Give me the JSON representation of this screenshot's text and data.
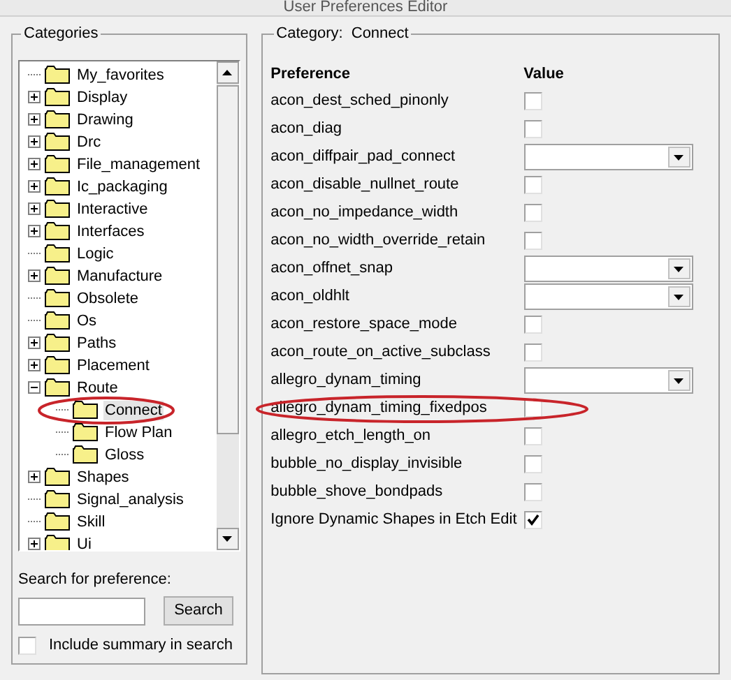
{
  "window": {
    "title": "User Preferences Editor"
  },
  "categories": {
    "title": "Categories",
    "tree": [
      {
        "label": "My_favorites",
        "kind": "leaf",
        "selected": false,
        "highlighted": false
      },
      {
        "label": "Display",
        "kind": "collapsed",
        "selected": false,
        "highlighted": false
      },
      {
        "label": "Drawing",
        "kind": "collapsed",
        "selected": false,
        "highlighted": false
      },
      {
        "label": "Drc",
        "kind": "collapsed",
        "selected": false,
        "highlighted": false
      },
      {
        "label": "File_management",
        "kind": "collapsed",
        "selected": false,
        "highlighted": false
      },
      {
        "label": "Ic_packaging",
        "kind": "collapsed",
        "selected": false,
        "highlighted": false
      },
      {
        "label": "Interactive",
        "kind": "collapsed",
        "selected": false,
        "highlighted": false
      },
      {
        "label": "Interfaces",
        "kind": "collapsed",
        "selected": false,
        "highlighted": false
      },
      {
        "label": "Logic",
        "kind": "leaf",
        "selected": false,
        "highlighted": false
      },
      {
        "label": "Manufacture",
        "kind": "collapsed",
        "selected": false,
        "highlighted": false
      },
      {
        "label": "Obsolete",
        "kind": "leaf",
        "selected": false,
        "highlighted": false
      },
      {
        "label": "Os",
        "kind": "leaf",
        "selected": false,
        "highlighted": false
      },
      {
        "label": "Paths",
        "kind": "collapsed",
        "selected": false,
        "highlighted": false
      },
      {
        "label": "Placement",
        "kind": "collapsed",
        "selected": false,
        "highlighted": false
      },
      {
        "label": "Route",
        "kind": "expanded",
        "selected": false,
        "highlighted": false,
        "children": [
          {
            "label": "Connect",
            "kind": "leaf",
            "selected": true,
            "highlighted": true
          },
          {
            "label": "Flow Plan",
            "kind": "leaf",
            "selected": false,
            "highlighted": false
          },
          {
            "label": "Gloss",
            "kind": "leaf",
            "selected": false,
            "highlighted": false
          }
        ]
      },
      {
        "label": "Shapes",
        "kind": "collapsed",
        "selected": false,
        "highlighted": false
      },
      {
        "label": "Signal_analysis",
        "kind": "leaf",
        "selected": false,
        "highlighted": false
      },
      {
        "label": "Skill",
        "kind": "leaf",
        "selected": false,
        "highlighted": false
      },
      {
        "label": "Ui",
        "kind": "collapsed",
        "selected": false,
        "highlighted": false
      }
    ],
    "search_label": "Search for preference:",
    "search_button": "Search",
    "include_summary": {
      "label": "Include summary in search",
      "checked": false
    }
  },
  "preferences": {
    "category_label": "Category:",
    "category": "Connect",
    "columns": [
      "Preference",
      "Value"
    ],
    "rows": [
      {
        "name": "acon_dest_sched_pinonly",
        "kind": "checkbox",
        "checked": false,
        "highlighted": false
      },
      {
        "name": "acon_diag",
        "kind": "checkbox",
        "checked": false,
        "highlighted": false
      },
      {
        "name": "acon_diffpair_pad_connect",
        "kind": "dropdown",
        "highlighted": false
      },
      {
        "name": "acon_disable_nullnet_route",
        "kind": "checkbox",
        "checked": false,
        "highlighted": false
      },
      {
        "name": "acon_no_impedance_width",
        "kind": "checkbox",
        "checked": false,
        "highlighted": false
      },
      {
        "name": "acon_no_width_override_retain",
        "kind": "checkbox",
        "checked": false,
        "highlighted": false
      },
      {
        "name": "acon_offnet_snap",
        "kind": "dropdown",
        "highlighted": false
      },
      {
        "name": "acon_oldhlt",
        "kind": "dropdown",
        "highlighted": false
      },
      {
        "name": "acon_restore_space_mode",
        "kind": "checkbox",
        "checked": false,
        "highlighted": false
      },
      {
        "name": "acon_route_on_active_subclass",
        "kind": "checkbox",
        "checked": false,
        "highlighted": false
      },
      {
        "name": "allegro_dynam_timing",
        "kind": "dropdown",
        "highlighted": false
      },
      {
        "name": "allegro_dynam_timing_fixedpos",
        "kind": "checkbox",
        "checked": false,
        "highlighted": true
      },
      {
        "name": "allegro_etch_length_on",
        "kind": "checkbox",
        "checked": false,
        "highlighted": false
      },
      {
        "name": "bubble_no_display_invisible",
        "kind": "checkbox",
        "checked": false,
        "highlighted": false
      },
      {
        "name": "bubble_shove_bondpads",
        "kind": "checkbox",
        "checked": false,
        "highlighted": false
      },
      {
        "name": "Ignore Dynamic Shapes in Etch Edit",
        "kind": "checkbox",
        "checked": true,
        "highlighted": false
      }
    ]
  }
}
